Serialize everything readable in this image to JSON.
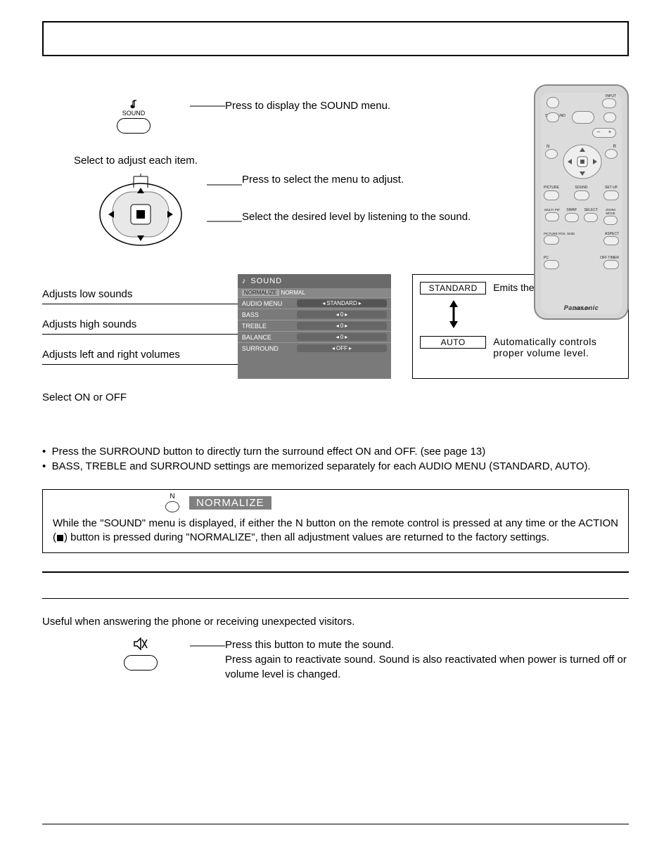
{
  "title_box": "",
  "step1": {
    "button_label": "SOUND",
    "text": "Press to display the SOUND menu."
  },
  "select_line": "Select to adjust each item.",
  "step2a": "Press to select the menu to adjust.",
  "step2b": "Select the desired level by listening to the sound.",
  "callouts": {
    "bass": "Adjusts low sounds",
    "treble": "Adjusts high sounds",
    "balance": "Adjusts left and right volumes",
    "surround": "Select ON or OFF"
  },
  "menu": {
    "header": "SOUND",
    "normalize_btn": "NORMALIZE",
    "normal_label": "NORMAL",
    "rows": {
      "audio_menu": {
        "label": "AUDIO MENU",
        "value": "STANDARD"
      },
      "bass": {
        "label": "BASS",
        "value": "0"
      },
      "treble": {
        "label": "TREBLE",
        "value": "0"
      },
      "balance": {
        "label": "BALANCE",
        "value": "0"
      },
      "surround": {
        "label": "SURROUND",
        "value": "OFF"
      }
    }
  },
  "modes": {
    "standard": {
      "label": "STANDARD",
      "desc": "Emits the original sound."
    },
    "auto": {
      "label": "AUTO",
      "desc": "Automatically controls proper volume level."
    }
  },
  "bullets": {
    "b1": "Press the SURROUND button to directly turn the surround effect ON and OFF. (see page 13)",
    "b2": "BASS, TREBLE and SURROUND settings are memorized separately for each AUDIO MENU (STANDARD, AUTO)."
  },
  "normalize": {
    "n": "N",
    "tag": "NORMALIZE",
    "body_before": "While the \"SOUND\" menu is displayed, if either the N button on the remote control is pressed at any time or the ACTION (",
    "body_after": ") button is pressed during \"NORMALIZE\", then all adjustment values are returned to the factory settings."
  },
  "mute": {
    "intro": "Useful when answering the phone or receiving unexpected visitors.",
    "line1": "Press this button to mute the sound.",
    "line2": "Press again to reactivate sound. Sound is also reactivated when power is turned off or volume level is changed."
  },
  "remote": {
    "input": "INPUT",
    "surround": "SURROUND",
    "n": "N",
    "r": "R",
    "picture": "PICTURE",
    "sound": "SOUND",
    "setup": "SET UP",
    "multi_pip": "MULTI PIP",
    "swap": "SWAP",
    "select": "SELECT",
    "zoom_move": "ZOOM MOVE",
    "pos_size": "PICTURE POS. /SIZE",
    "aspect": "ASPECT",
    "pc": "PC",
    "off_timer": "OFF TIMER",
    "brand": "Panasonic",
    "brand2": "DISPLAY"
  }
}
